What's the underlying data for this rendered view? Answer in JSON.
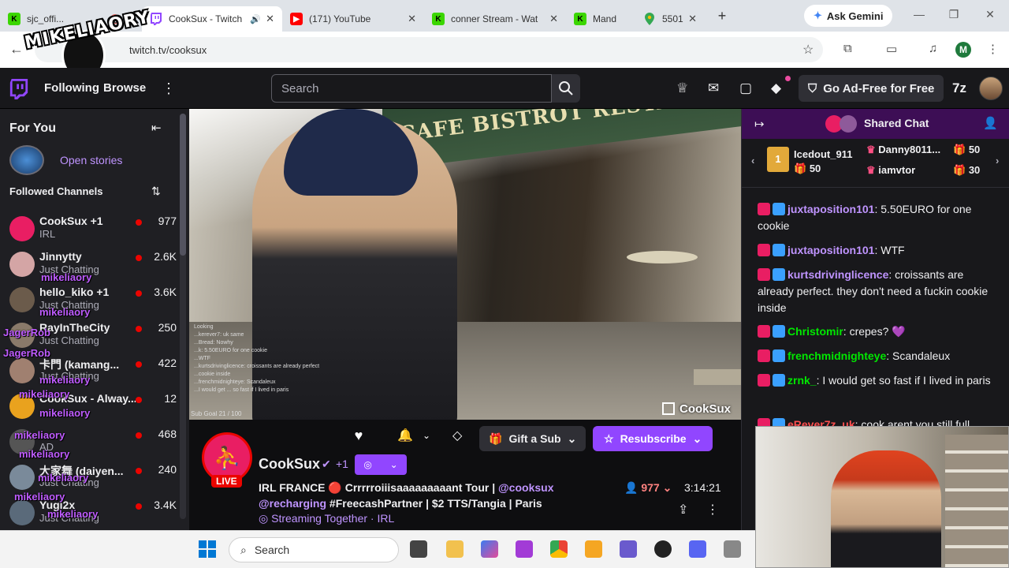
{
  "browser": {
    "tabs": [
      {
        "title": "sjc_offi...",
        "icon": "kick-icon",
        "muted": true
      },
      {
        "title": "CookSux - Twitch",
        "icon": "twitch-icon",
        "active": true,
        "audio": true
      },
      {
        "title": "(171) YouTube",
        "icon": "youtube-icon"
      },
      {
        "title": "conner Stream - Wat",
        "icon": "kick-icon"
      },
      {
        "title": "Mand",
        "icon": "kick-icon"
      },
      {
        "title": "5501",
        "icon": "maps-icon"
      }
    ],
    "gemini_label": "Ask Gemini",
    "url": "twitch.tv/cooksux",
    "profile_initial": "M"
  },
  "twitch": {
    "nav": {
      "following": "Following",
      "browse": "Browse",
      "search_placeholder": "Search",
      "adfree": "Go Ad-Free for Free"
    },
    "sidebar": {
      "title": "For You",
      "open_stories": "Open stories",
      "followed_header": "Followed Channels",
      "channels": [
        {
          "name": "CookSux +1",
          "category": "IRL",
          "viewers": "977",
          "color": "#e91e63"
        },
        {
          "name": "Jinnytty",
          "category": "Just Chatting",
          "viewers": "2.6K",
          "color": "#d4a5a5"
        },
        {
          "name": "hello_kiko +1",
          "category": "Just Chatting",
          "viewers": "3.6K",
          "color": "#6b5b4b"
        },
        {
          "name": "RayInTheCity",
          "category": "Just Chatting",
          "viewers": "250",
          "color": "#8a7a6a"
        },
        {
          "name": "卡門 (kamang...",
          "category": "Just Chatting",
          "viewers": "422",
          "color": "#a08070"
        },
        {
          "name": "CookSux - Alway...",
          "category": "",
          "viewers": "12",
          "color": "#e9a21e"
        },
        {
          "name": "",
          "category": "AD",
          "viewers": "468",
          "color": "#555555"
        },
        {
          "name": "大家舞 (daiyen...",
          "category": "Just Chatting",
          "viewers": "240",
          "color": "#7a8a9a"
        },
        {
          "name": "Yugi2x",
          "category": "Just Chatting",
          "viewers": "3.4K",
          "color": "#5a6a7a"
        }
      ]
    },
    "overlay": {
      "watermark": "MIKELIAORY",
      "names": [
        "mikeliaory",
        "mikeliaory",
        "JagerRob",
        "JagerRob",
        "mikeliaory",
        "mikeliaory",
        "mikeliaory",
        "mikeliaory",
        "mikeliaory",
        "mikeliaory",
        "mikeliaory",
        "mikeliaory",
        "mikeliaory",
        "mikeliaory",
        "mikeliaory"
      ]
    },
    "video": {
      "sign": "CAFE BISTROT RESTAURANT",
      "watermark": "CookSux",
      "subgoal": "Sub Goal 21 / 100",
      "mini_chat": [
        "Looking",
        "...kerever7: uk same",
        "...Bread: Nowhy",
        "...k: 5.50EURO for one cookie",
        "...WTF",
        "...kurtsdrivinglicence: croissants are already perfect",
        "...cookie inside",
        "...frenchmidnighteye: Scandaleux",
        "...I would get ... so fast if I lived in paris"
      ]
    },
    "channel": {
      "name": "CookSux",
      "plus": "+1",
      "live": "LIVE",
      "gift_sub": "Gift a Sub",
      "resubscribe": "Resubscribe",
      "title_pre": "IRL FRANCE 🔴 Crrrrroiiisaaaaaaaaant Tour | ",
      "title_mention1": "@cooksux",
      "title_mention2": "@recharging",
      "title_post": " #FreecashPartner | $2 TTS/Tangia | Paris",
      "category": "Streaming Together · IRL",
      "viewers": "977",
      "uptime": "3:14:21"
    },
    "chat": {
      "title": "Shared Chat",
      "leaderboard": [
        {
          "name": "Icedout_911",
          "points": "50",
          "rank": "1"
        },
        {
          "name": "Danny8011...",
          "points": "50"
        },
        {
          "name": "iamvtor",
          "points": "30"
        }
      ],
      "messages": [
        {
          "user": "juxtaposition101",
          "text": ": 5.50EURO for one cookie",
          "color": "#bf94ff"
        },
        {
          "user": "juxtaposition101",
          "text": ": WTF",
          "color": "#bf94ff"
        },
        {
          "user": "kurtsdrivinglicence",
          "text": ": croissants are already perfect. they don't need a fuckin cookie inside",
          "color": "#bf94ff"
        },
        {
          "user": "Christomir",
          "text": ": crepes? 💜",
          "color": "#00e700"
        },
        {
          "user": "frenchmidnighteye",
          "text": ": Scandaleux",
          "color": "#00e700"
        },
        {
          "user": "zrnk_",
          "text": ": I would get            so fast if I lived in paris",
          "color": "#00e700"
        },
        {
          "user": "eRever7z_uk",
          "text": ": cook arent you still full",
          "color": "#ff4f4f"
        }
      ]
    }
  },
  "taskbar": {
    "search_placeholder": "Search"
  }
}
